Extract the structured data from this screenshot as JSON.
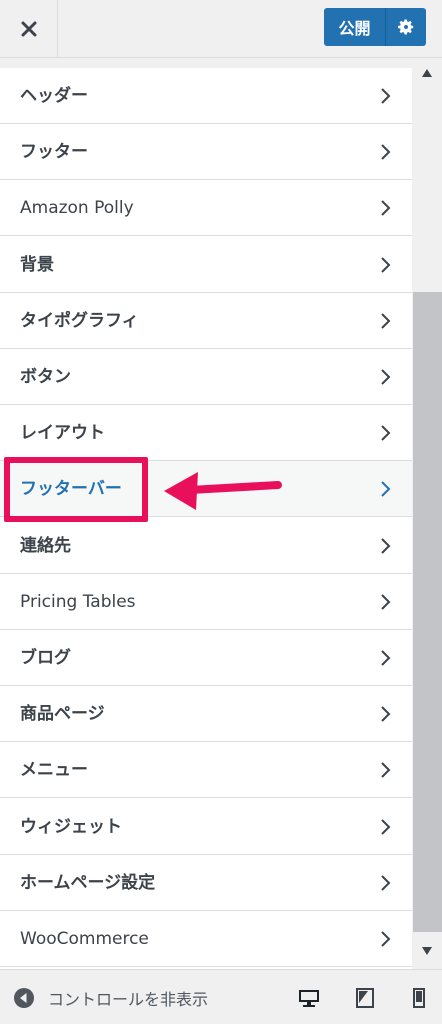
{
  "header": {
    "close_label": "×",
    "publish_label": "公開"
  },
  "menu": {
    "items": [
      {
        "label": "ヘッダー"
      },
      {
        "label": "フッター"
      },
      {
        "label": "Amazon Polly"
      },
      {
        "label": "背景"
      },
      {
        "label": "タイポグラフィ"
      },
      {
        "label": "ボタン"
      },
      {
        "label": "レイアウト"
      },
      {
        "label": "フッターバー",
        "active": true
      },
      {
        "label": "連絡先"
      },
      {
        "label": "Pricing Tables"
      },
      {
        "label": "ブログ"
      },
      {
        "label": "商品ページ"
      },
      {
        "label": "メニュー"
      },
      {
        "label": "ウィジェット"
      },
      {
        "label": "ホームページ設定"
      },
      {
        "label": "WooCommerce"
      }
    ]
  },
  "footer": {
    "collapse_label": "コントロールを非表示"
  },
  "colors": {
    "accent": "#2271b1",
    "highlight": "#e8105a"
  }
}
